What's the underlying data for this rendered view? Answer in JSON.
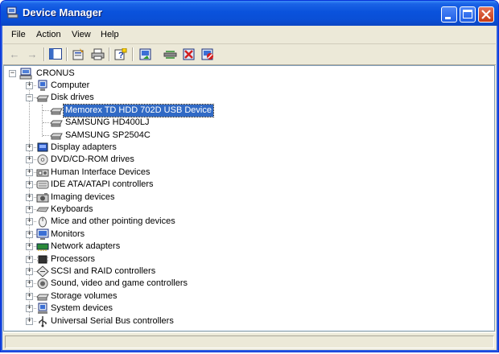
{
  "window": {
    "title": "Device Manager",
    "title_icon": "device-manager-icon",
    "controls": [
      "minimize-icon",
      "maximize-icon",
      "close-icon"
    ]
  },
  "menu": [
    {
      "label": "File"
    },
    {
      "label": "Action"
    },
    {
      "label": "View"
    },
    {
      "label": "Help"
    }
  ],
  "toolbar": {
    "buttons": [
      "back-icon",
      "forward-icon",
      "show-hide-tree-icon",
      "properties-icon",
      "print-icon",
      "help-icon",
      "update-driver-icon",
      "scan-hardware-icon",
      "uninstall-icon",
      "disable-icon"
    ]
  },
  "tree": {
    "root": "CRONUS",
    "items": [
      {
        "label": "Computer",
        "icon": "computer-icon",
        "state": "collapsed"
      },
      {
        "label": "Disk drives",
        "icon": "disk-drive-icon",
        "state": "expanded",
        "children": [
          {
            "label": "Memorex TD HDD 702D USB Device",
            "icon": "disk-drive-icon",
            "selected": true
          },
          {
            "label": "SAMSUNG HD400LJ",
            "icon": "disk-drive-icon"
          },
          {
            "label": "SAMSUNG SP2504C",
            "icon": "disk-drive-icon"
          }
        ]
      },
      {
        "label": "Display adapters",
        "icon": "display-adapter-icon",
        "state": "collapsed"
      },
      {
        "label": "DVD/CD-ROM drives",
        "icon": "cd-drive-icon",
        "state": "collapsed"
      },
      {
        "label": "Human Interface Devices",
        "icon": "hid-icon",
        "state": "collapsed"
      },
      {
        "label": "IDE ATA/ATAPI controllers",
        "icon": "ide-controller-icon",
        "state": "collapsed"
      },
      {
        "label": "Imaging devices",
        "icon": "camera-icon",
        "state": "collapsed"
      },
      {
        "label": "Keyboards",
        "icon": "keyboard-icon",
        "state": "collapsed"
      },
      {
        "label": "Mice and other pointing devices",
        "icon": "mouse-icon",
        "state": "collapsed"
      },
      {
        "label": "Monitors",
        "icon": "monitor-icon",
        "state": "collapsed"
      },
      {
        "label": "Network adapters",
        "icon": "network-adapter-icon",
        "state": "collapsed"
      },
      {
        "label": "Processors",
        "icon": "processor-icon",
        "state": "collapsed"
      },
      {
        "label": "SCSI and RAID controllers",
        "icon": "scsi-icon",
        "state": "collapsed"
      },
      {
        "label": "Sound, video and game controllers",
        "icon": "sound-icon",
        "state": "collapsed"
      },
      {
        "label": "Storage volumes",
        "icon": "storage-volume-icon",
        "state": "collapsed"
      },
      {
        "label": "System devices",
        "icon": "system-device-icon",
        "state": "collapsed"
      },
      {
        "label": "Universal Serial Bus controllers",
        "icon": "usb-icon",
        "state": "collapsed"
      }
    ]
  },
  "colors": {
    "titlebar": "#0a52dc",
    "selection": "#316ac5",
    "window_face": "#ece9d8"
  }
}
